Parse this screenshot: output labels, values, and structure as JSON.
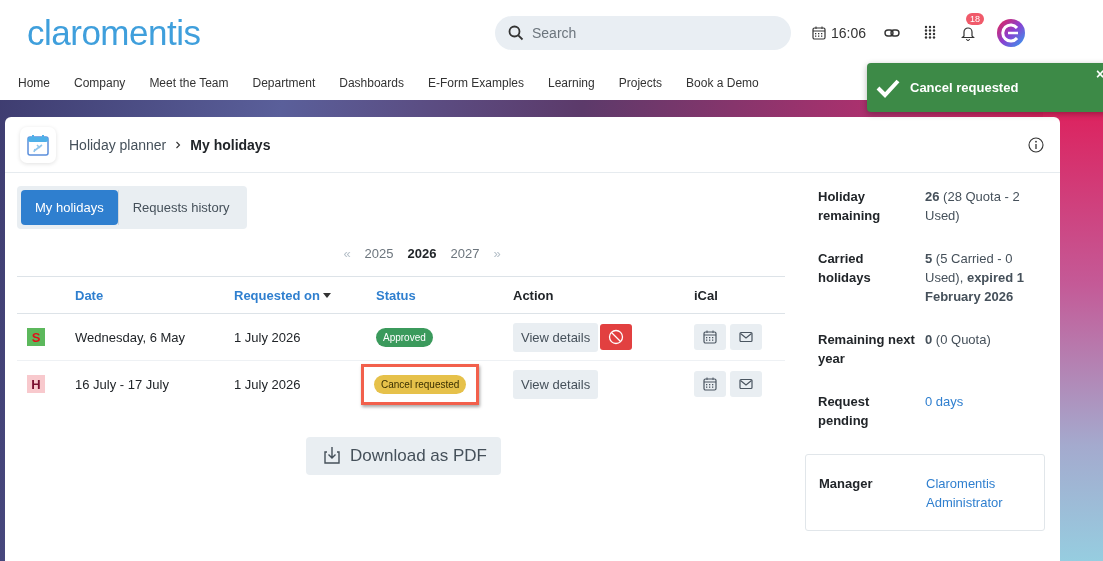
{
  "header": {
    "logo": "claromentis",
    "search": {
      "placeholder": "Search"
    },
    "time": "16:06",
    "notifications": "18"
  },
  "nav": [
    "Home",
    "Company",
    "Meet the Team",
    "Department",
    "Dashboards",
    "E-Form Examples",
    "Learning",
    "Projects",
    "Book a Demo"
  ],
  "toast": {
    "message": "Cancel requested",
    "close": "×"
  },
  "breadcrumb": {
    "parent": "Holiday planner",
    "current": "My holidays"
  },
  "tabs": [
    {
      "label": "My holidays",
      "selected": true
    },
    {
      "label": "Requests history",
      "selected": false
    }
  ],
  "years": {
    "prev": "«",
    "items": [
      {
        "label": "2025",
        "selected": false
      },
      {
        "label": "2026",
        "selected": true
      },
      {
        "label": "2027",
        "selected": false
      }
    ],
    "next": "»"
  },
  "table": {
    "columns": [
      {
        "label": "Date",
        "kind": "link"
      },
      {
        "label": "Requested on",
        "kind": "sorted"
      },
      {
        "label": "Status",
        "kind": "link"
      },
      {
        "label": "Action",
        "kind": "plain"
      },
      {
        "label": "iCal",
        "kind": "plain"
      }
    ],
    "rows": [
      {
        "type": "S",
        "color": "#5cb85c",
        "date": "Wednesday, 6 May",
        "requested": "1 July 2026",
        "status": {
          "label": "Approved",
          "kind": "approved"
        },
        "action": "View details",
        "cancellable": true,
        "highlighted": false
      },
      {
        "type": "H",
        "color": "#f8c9cd",
        "date": "16 July - 17 July",
        "requested": "1 July 2026",
        "status": {
          "label": "Cancel requested",
          "kind": "cancel_requested"
        },
        "action": "View details",
        "cancellable": false,
        "highlighted": true
      }
    ]
  },
  "download": "Download as PDF",
  "summary": [
    {
      "label": "Holiday remaining",
      "value": "**26** (28 Quota - 2 Used)",
      "kind": "text"
    },
    {
      "label": "Carried holidays",
      "value": "**5** (5 Carried - 0 Used), **expired 1 February 2026**",
      "kind": "text"
    },
    {
      "label": "Remaining next year",
      "value": "**0** (0 Quota)",
      "kind": "text"
    },
    {
      "label": "Request pending",
      "value": "0 days",
      "kind": "link"
    }
  ],
  "manager": {
    "label": "Manager",
    "value": "Claromentis Administrator"
  }
}
